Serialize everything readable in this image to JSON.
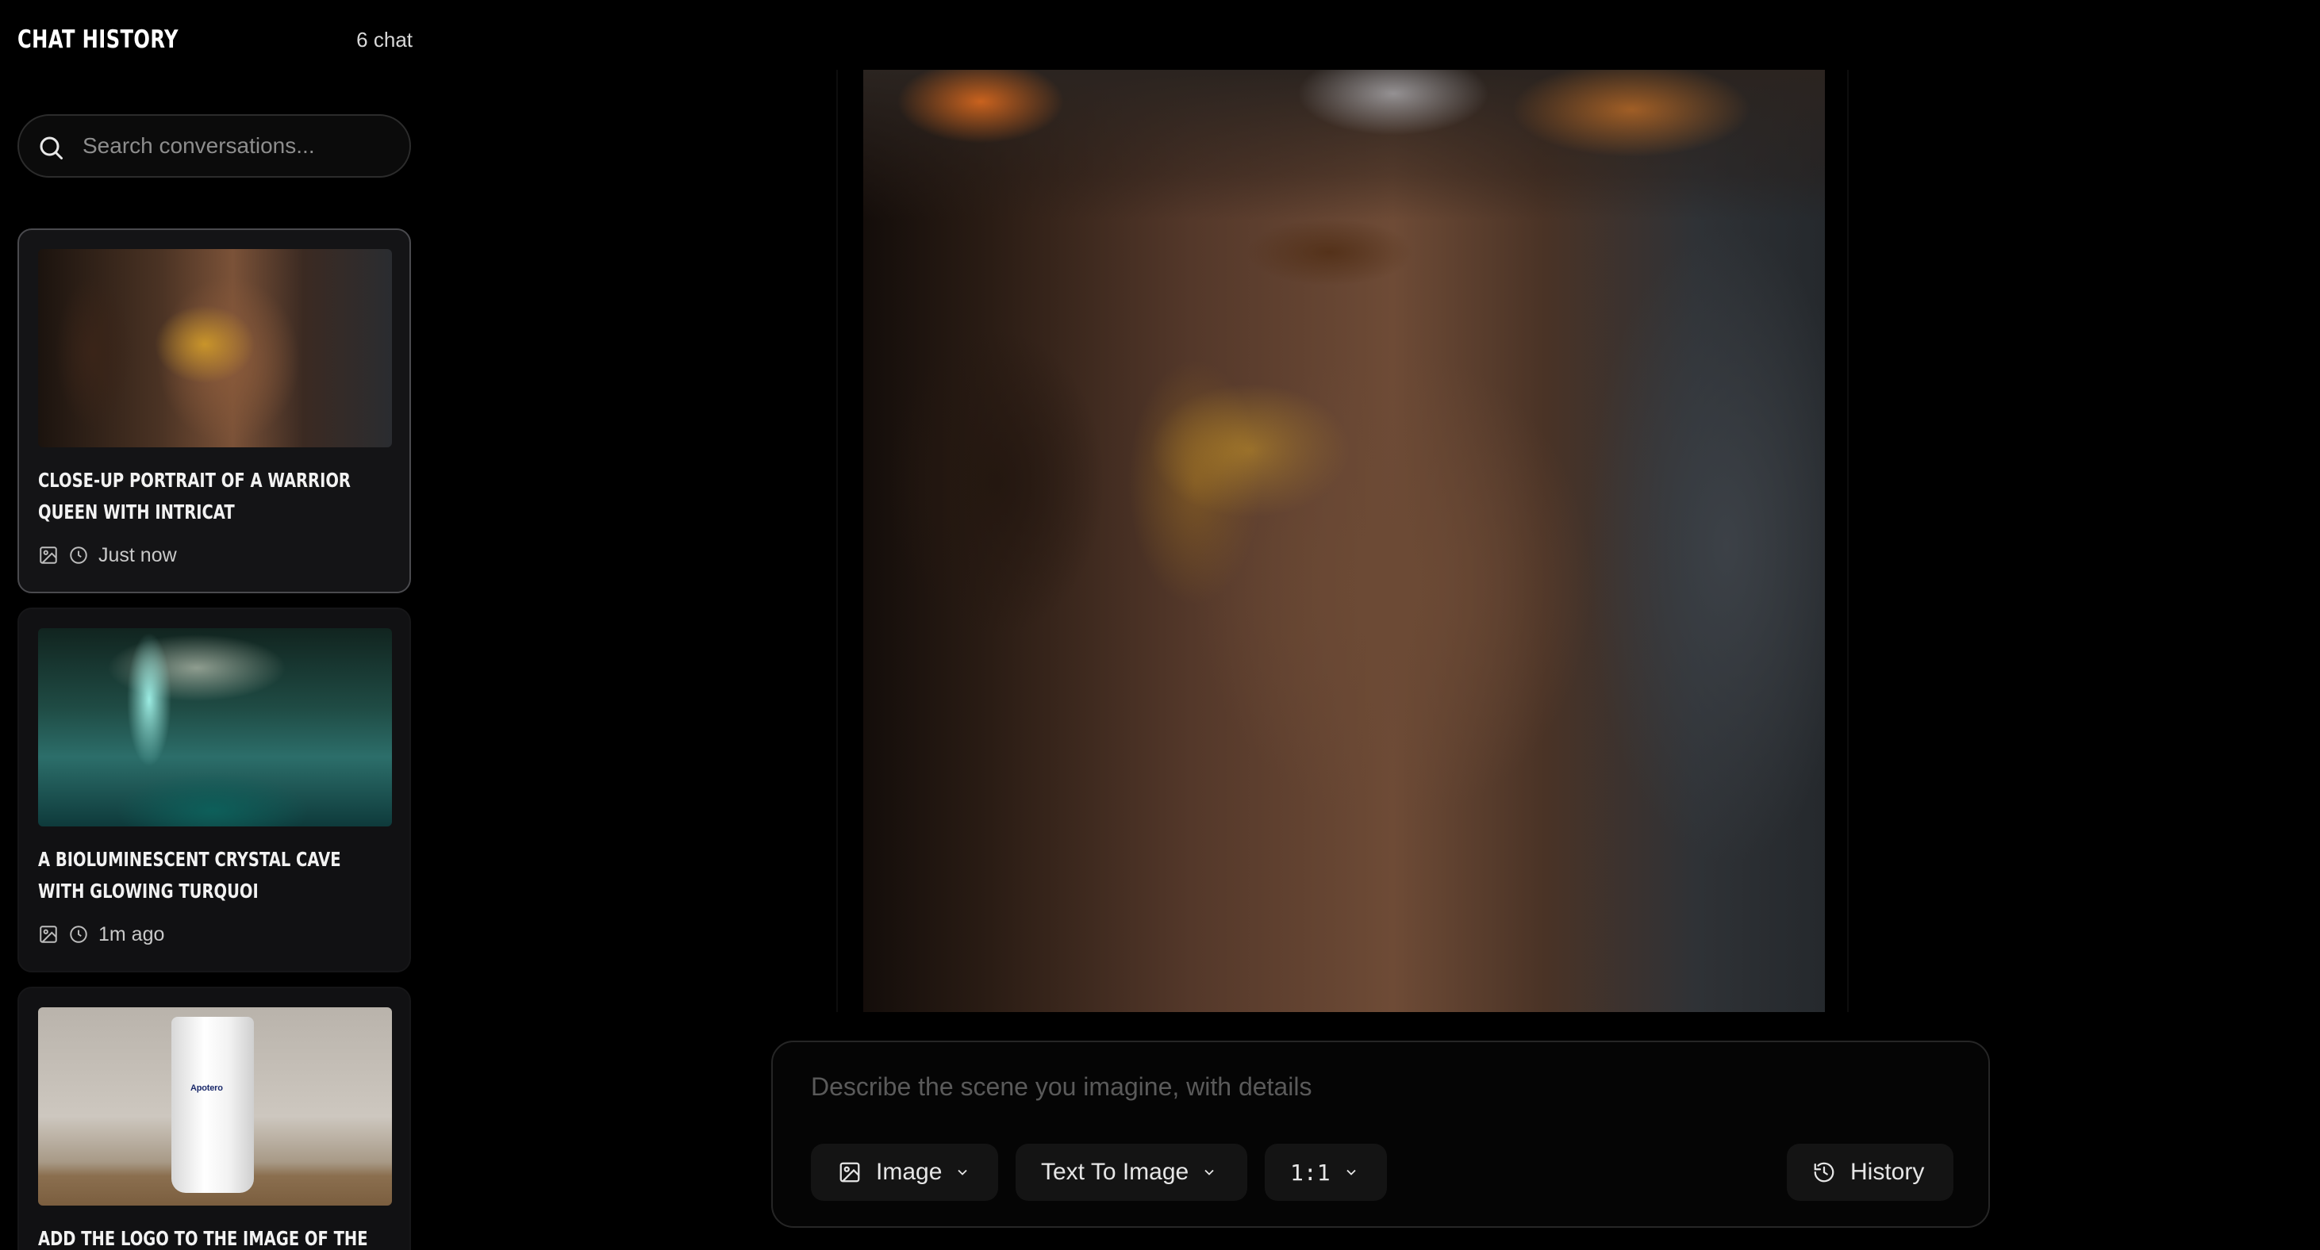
{
  "sidebar": {
    "title": "CHAT HISTORY",
    "count": "6 chat",
    "search": {
      "placeholder": "Search conversations..."
    },
    "items": [
      {
        "title": "CLOSE-UP PORTRAIT OF A WARRIOR QUEEN WITH INTRICAT",
        "time": "Just now",
        "active": true,
        "thumbnail": "warrior-queen"
      },
      {
        "title": "A BIOLUMINESCENT CRYSTAL CAVE WITH GLOWING TURQUOI",
        "time": "1m ago",
        "active": false,
        "thumbnail": "crystal-cave"
      },
      {
        "title": "ADD THE LOGO TO THE IMAGE OF THE",
        "time": "",
        "active": false,
        "thumbnail": "product-tube",
        "thumbnail_text": "Apotero"
      }
    ]
  },
  "main": {
    "image_alt": "Close-up portrait of a warrior queen"
  },
  "composer": {
    "placeholder": "Describe the scene you imagine, with details",
    "mode_label": "Image",
    "type_label": "Text To Image",
    "ratio_label": "1:1",
    "history_label": "History"
  },
  "colors": {
    "background": "#000000",
    "card": "#111113",
    "card_active_border": "#4a4a4e",
    "pill": "#141414"
  }
}
